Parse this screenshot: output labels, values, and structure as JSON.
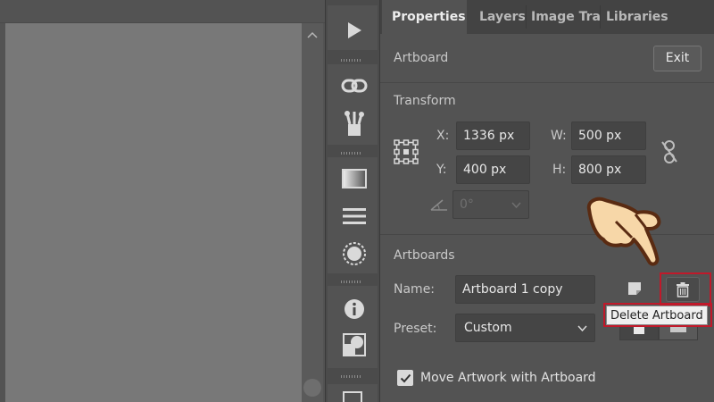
{
  "colors": {
    "panel_bg": "#535353",
    "canvas_bg": "#787878",
    "highlight": "#c0192a",
    "tooltip_bg": "#f0f0f0",
    "hand_fill": "#f7d7a8"
  },
  "tabs": [
    {
      "label": "Properties",
      "active": true
    },
    {
      "label": "Layers",
      "active": false
    },
    {
      "label": "Image Tra",
      "active": false
    },
    {
      "label": "Libraries",
      "active": false
    }
  ],
  "artboard": {
    "heading": "Artboard",
    "exit_label": "Exit"
  },
  "transform": {
    "heading": "Transform",
    "x_label": "X:",
    "x_value": "1336 px",
    "y_label": "Y:",
    "y_value": "400 px",
    "w_label": "W:",
    "w_value": "500 px",
    "h_label": "H:",
    "h_value": "800 px",
    "rotate_value": "0°"
  },
  "artboards": {
    "heading": "Artboards",
    "name_label": "Name:",
    "name_value": "Artboard 1 copy",
    "preset_label": "Preset:",
    "preset_value": "Custom",
    "delete_tooltip": "Delete Artboard",
    "move_artwork_label": "Move Artwork with Artboard",
    "move_artwork_checked": true
  },
  "toolbar_icons": [
    "play-icon",
    "link-icon",
    "brushes-icon",
    "gradient-icon",
    "align-icon",
    "appearance-icon",
    "info-icon",
    "pathfinder-icon"
  ]
}
